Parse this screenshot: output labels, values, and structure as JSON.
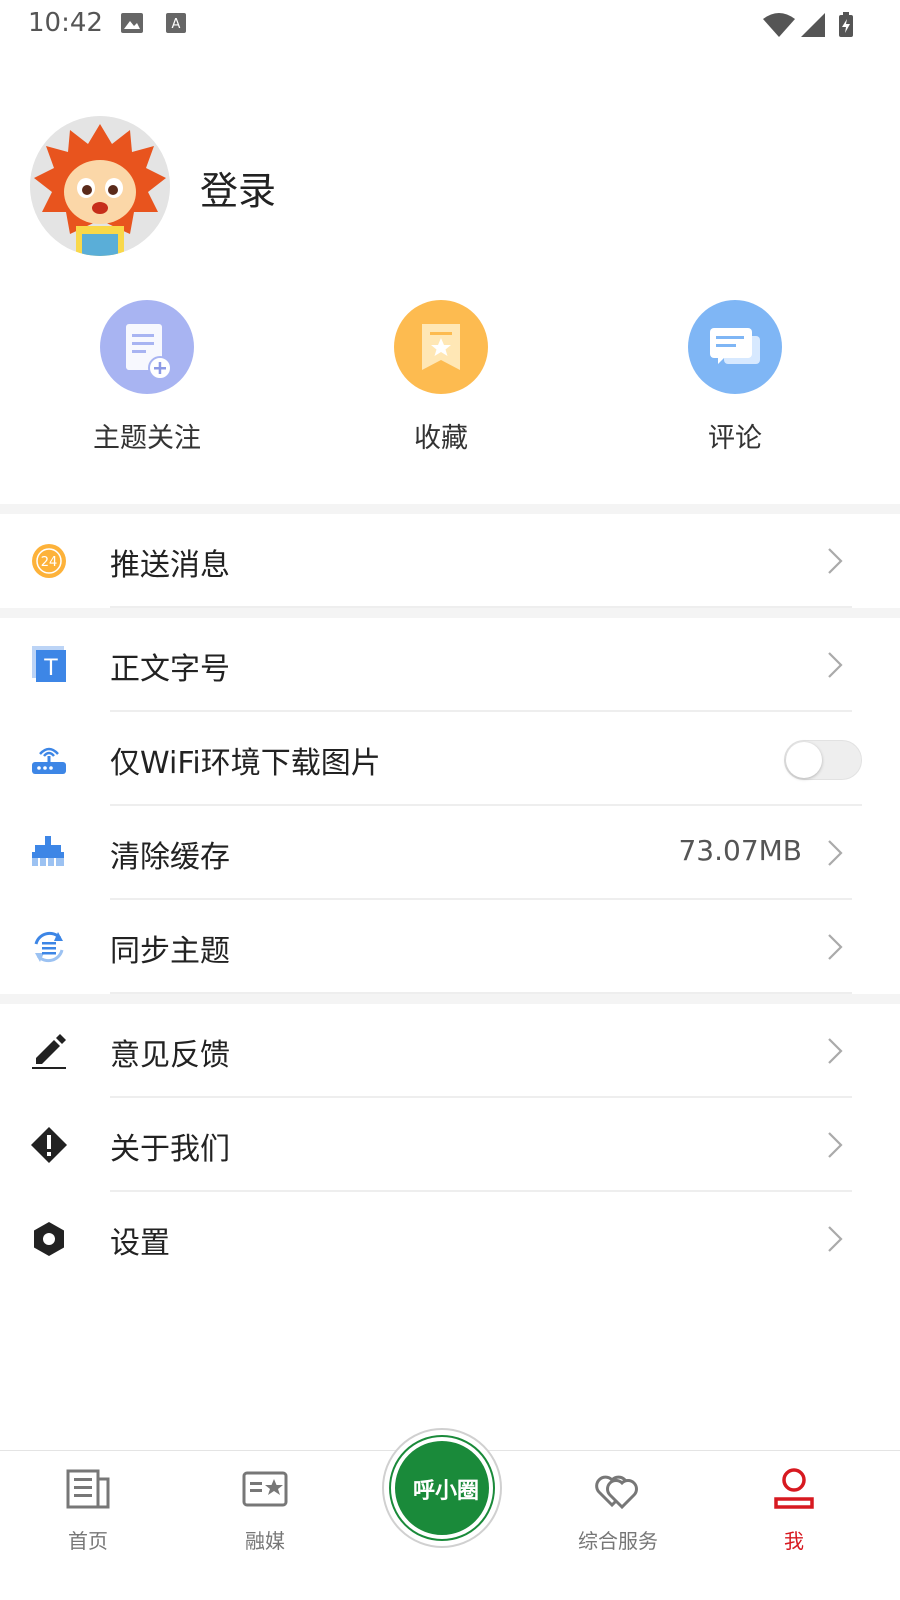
{
  "status_bar": {
    "time": "10:42"
  },
  "profile": {
    "login_label": "登录"
  },
  "quick_actions": [
    {
      "label": "主题关注",
      "icon": "topic-follow-icon",
      "color": "#a8b4f2"
    },
    {
      "label": "收藏",
      "icon": "bookmark-star-icon",
      "color": "#fdbb50"
    },
    {
      "label": "评论",
      "icon": "comment-icon",
      "color": "#7fb6f5"
    }
  ],
  "menu": {
    "push": {
      "label": "推送消息",
      "badge": "24"
    },
    "font_size": {
      "label": "正文字号"
    },
    "wifi_images": {
      "label": "仅WiFi环境下载图片",
      "enabled": false
    },
    "clear_cache": {
      "label": "清除缓存",
      "value": "73.07MB"
    },
    "sync_topics": {
      "label": "同步主题"
    },
    "feedback": {
      "label": "意见反馈"
    },
    "about": {
      "label": "关于我们"
    },
    "settings": {
      "label": "设置"
    }
  },
  "bottom_nav": {
    "items": [
      {
        "label": "首页",
        "icon": "newspaper-icon"
      },
      {
        "label": "融媒",
        "icon": "media-card-icon"
      },
      {
        "label": "综合服务",
        "icon": "heart-service-icon"
      },
      {
        "label": "我",
        "icon": "user-icon",
        "active": true
      }
    ],
    "center_logo_text": "呼小圈"
  },
  "colors": {
    "accent": "#d71920",
    "logo_green": "#1a8a3a"
  }
}
